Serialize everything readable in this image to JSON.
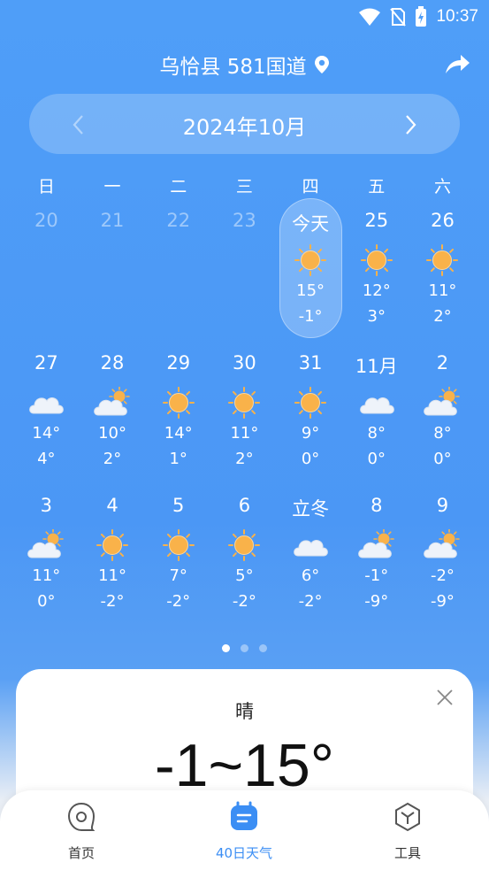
{
  "status": {
    "time": "10:37"
  },
  "header": {
    "location": "乌恰县 581国道"
  },
  "calendar": {
    "month_title": "2024年10月",
    "weekdays": [
      "日",
      "一",
      "二",
      "三",
      "四",
      "五",
      "六"
    ],
    "weeks": [
      [
        {
          "day": "20",
          "past": true
        },
        {
          "day": "21",
          "past": true
        },
        {
          "day": "22",
          "past": true
        },
        {
          "day": "23",
          "past": true
        },
        {
          "day": "今天",
          "icon": "sun-icon",
          "hi": "15°",
          "lo": "-1°",
          "today": true
        },
        {
          "day": "25",
          "icon": "sun-icon",
          "hi": "12°",
          "lo": "3°"
        },
        {
          "day": "26",
          "icon": "sun-icon",
          "hi": "11°",
          "lo": "2°"
        }
      ],
      [
        {
          "day": "27",
          "icon": "cloud-icon",
          "hi": "14°",
          "lo": "4°"
        },
        {
          "day": "28",
          "icon": "partly-cloudy-icon",
          "hi": "10°",
          "lo": "2°"
        },
        {
          "day": "29",
          "icon": "sun-icon",
          "hi": "14°",
          "lo": "1°"
        },
        {
          "day": "30",
          "icon": "sun-icon",
          "hi": "11°",
          "lo": "2°"
        },
        {
          "day": "31",
          "icon": "sun-icon",
          "hi": "9°",
          "lo": "0°"
        },
        {
          "day": "11月",
          "icon": "cloud-icon",
          "hi": "8°",
          "lo": "0°"
        },
        {
          "day": "2",
          "icon": "partly-cloudy-icon",
          "hi": "8°",
          "lo": "0°"
        }
      ],
      [
        {
          "day": "3",
          "icon": "partly-cloudy-icon",
          "hi": "11°",
          "lo": "0°"
        },
        {
          "day": "4",
          "icon": "sun-icon",
          "hi": "11°",
          "lo": "-2°"
        },
        {
          "day": "5",
          "icon": "sun-icon",
          "hi": "7°",
          "lo": "-2°"
        },
        {
          "day": "6",
          "icon": "sun-icon",
          "hi": "5°",
          "lo": "-2°"
        },
        {
          "day": "立冬",
          "icon": "cloud-icon",
          "hi": "6°",
          "lo": "-2°"
        },
        {
          "day": "8",
          "icon": "partly-cloudy-icon",
          "hi": "-1°",
          "lo": "-9°"
        },
        {
          "day": "9",
          "icon": "partly-cloudy-icon",
          "hi": "-2°",
          "lo": "-9°"
        }
      ]
    ]
  },
  "detail": {
    "weather": "晴",
    "range": "-1~15°"
  },
  "nav": {
    "items": [
      {
        "label": "首页",
        "icon": "home-icon"
      },
      {
        "label": "40日天气",
        "icon": "calendar-icon",
        "active": true
      },
      {
        "label": "工具",
        "icon": "tools-icon"
      }
    ]
  },
  "colors": {
    "accent": "#3b8ef4",
    "sun": "#f9b24a"
  }
}
